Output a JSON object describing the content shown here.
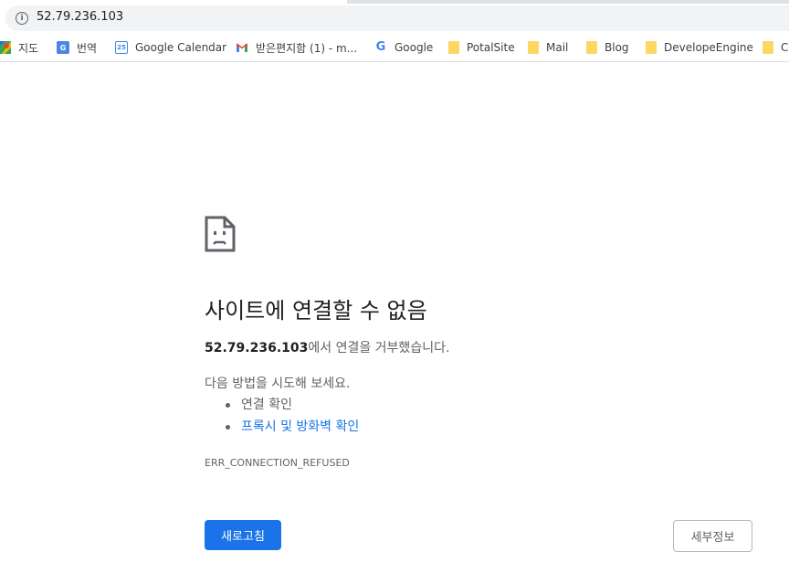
{
  "address_bar": {
    "url": "52.79.236.103"
  },
  "bookmarks": [
    {
      "label": "지도",
      "icon": "google-maps-icon"
    },
    {
      "label": "번역",
      "icon": "google-translate-icon"
    },
    {
      "label": "Google Calendar",
      "icon": "google-calendar-icon",
      "icon_text": "25"
    },
    {
      "label": "받은편지함 (1) - m...",
      "icon": "gmail-icon"
    },
    {
      "label": "Google",
      "icon": "google-g-icon",
      "icon_text": "G"
    },
    {
      "label": "PotalSite",
      "icon": "folder-icon"
    },
    {
      "label": "Mail",
      "icon": "folder-icon"
    },
    {
      "label": "Blog",
      "icon": "folder-icon"
    },
    {
      "label": "DevelopeEngine",
      "icon": "folder-icon"
    },
    {
      "label": "C",
      "icon": "folder-icon"
    }
  ],
  "error_page": {
    "title": "사이트에 연결할 수 없음",
    "host": "52.79.236.103",
    "message_suffix": "에서 연결을 거부했습니다.",
    "try_heading": "다음 방법을 시도해 보세요.",
    "suggestions": [
      "연결 확인",
      "프록시 및 방화벽 확인"
    ],
    "error_code": "ERR_CONNECTION_REFUSED",
    "reload_label": "새로고침",
    "details_label": "세부정보"
  },
  "colors": {
    "accent": "#1a73e8",
    "text_primary": "#202124",
    "text_secondary": "#5f6368",
    "folder": "#fdd663"
  }
}
